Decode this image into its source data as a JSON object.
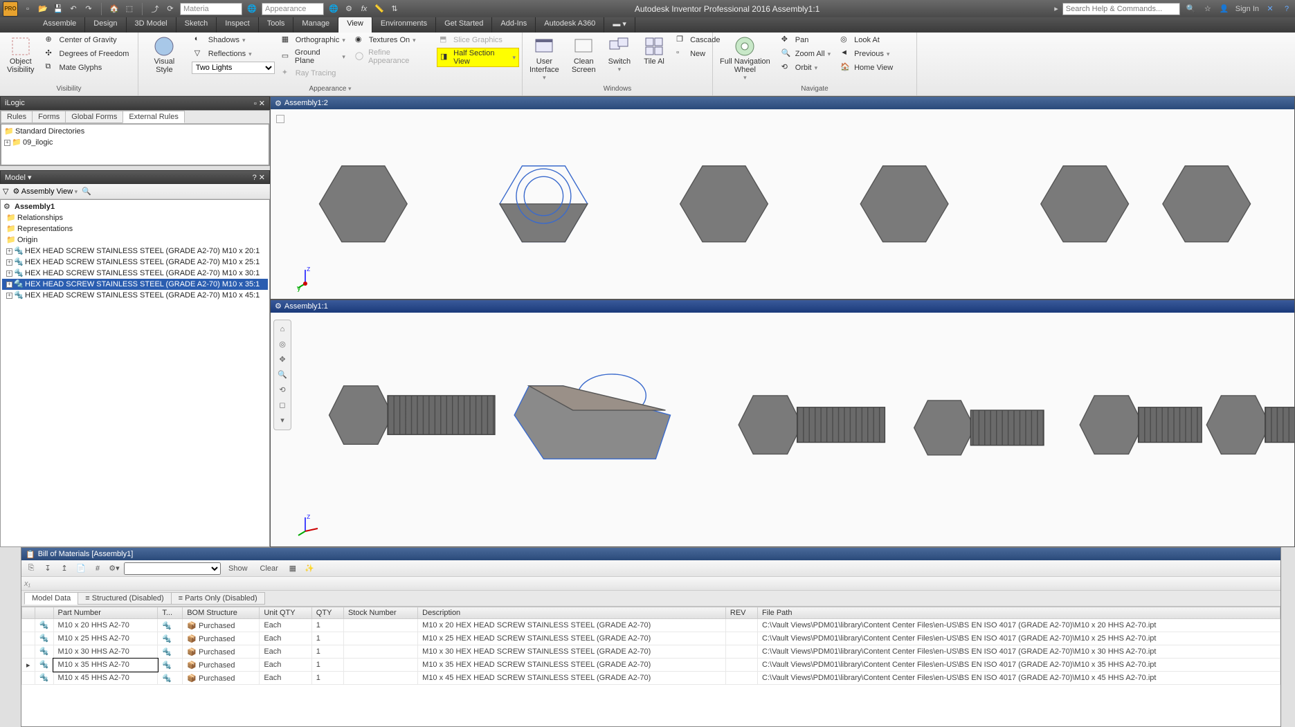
{
  "titlebar": {
    "material_placeholder": "Materia",
    "appearance_placeholder": "Appearance",
    "app_title": "Autodesk Inventor Professional 2016   Assembly1:1",
    "search_placeholder": "Search Help & Commands...",
    "signin": "Sign In"
  },
  "maintabs": [
    "Assemble",
    "Design",
    "3D Model",
    "Sketch",
    "Inspect",
    "Tools",
    "Manage",
    "View",
    "Environments",
    "Get Started",
    "Add-Ins",
    "Autodesk A360"
  ],
  "maintabs_active": 7,
  "ribbon": {
    "visibility": {
      "object_visibility": "Object\nVisibility",
      "center_of_gravity": "Center of Gravity",
      "degrees_of_freedom": "Degrees of Freedom",
      "mate_glyphs": "Mate Glyphs",
      "label": "Visibility"
    },
    "appearance": {
      "visual_style": "Visual Style",
      "shadows": "Shadows",
      "reflections": "Reflections",
      "two_lights": "Two Lights",
      "orthographic": "Orthographic",
      "ground_plane": "Ground Plane",
      "ray_tracing": "Ray Tracing",
      "textures_on": "Textures On",
      "refine_appearance": "Refine Appearance",
      "slice_graphics": "Slice Graphics",
      "half_section_view": "Half Section View",
      "label": "Appearance"
    },
    "windows": {
      "user_interface": "User\nInterface",
      "clean_screen": "Clean\nScreen",
      "switch": "Switch",
      "tile_all": "Tile Al",
      "cascade": "Cascade",
      "new": "New",
      "label": "Windows"
    },
    "navigate": {
      "full_nav_wheel": "Full Navigation\nWheel",
      "pan": "Pan",
      "zoom_all": "Zoom All",
      "orbit": "Orbit",
      "look_at": "Look At",
      "previous": "Previous",
      "home_view": "Home View",
      "label": "Navigate"
    }
  },
  "ilogic": {
    "title": "iLogic",
    "tabs": [
      "Rules",
      "Forms",
      "Global Forms",
      "External Rules"
    ],
    "active_tab": 3,
    "items": [
      "Standard Directories",
      "09_ilogic"
    ]
  },
  "model": {
    "title": "Model",
    "view_label": "Assembly View",
    "root": "Assembly1",
    "nodes": [
      "Relationships",
      "Representations",
      "Origin",
      "HEX HEAD SCREW STAINLESS STEEL (GRADE A2-70) M10 x 20:1",
      "HEX HEAD SCREW STAINLESS STEEL (GRADE A2-70) M10 x 25:1",
      "HEX HEAD SCREW STAINLESS STEEL (GRADE A2-70) M10 x 30:1",
      "HEX HEAD SCREW STAINLESS STEEL (GRADE A2-70) M10 x 35:1",
      "HEX HEAD SCREW STAINLESS STEEL (GRADE A2-70) M10 x 45:1"
    ],
    "selected_index": 6
  },
  "viewports": {
    "vp1_title": "Assembly1:2",
    "vp2_title": "Assembly1:1"
  },
  "bom": {
    "title": "Bill of Materials [Assembly1]",
    "show": "Show",
    "clear": "Clear",
    "tabs": [
      "Model Data",
      "Structured (Disabled)",
      "Parts Only (Disabled)"
    ],
    "active_tab": 0,
    "columns": [
      "Part Number",
      "T...",
      "BOM Structure",
      "Unit QTY",
      "QTY",
      "Stock Number",
      "Description",
      "REV",
      "File Path"
    ],
    "rows": [
      {
        "pn": "M10 x 20 HHS A2-70",
        "bom": "Purchased",
        "uqty": "Each",
        "qty": "1",
        "stock": "",
        "desc": "M10 x 20 HEX HEAD SCREW STAINLESS STEEL (GRADE A2-70)",
        "rev": "",
        "path": "C:\\Vault Views\\PDM01\\library\\Content Center Files\\en-US\\BS EN ISO 4017 (GRADE A2-70)\\M10 x 20 HHS A2-70.ipt"
      },
      {
        "pn": "M10 x 25 HHS A2-70",
        "bom": "Purchased",
        "uqty": "Each",
        "qty": "1",
        "stock": "",
        "desc": "M10 x 25 HEX HEAD SCREW STAINLESS STEEL (GRADE A2-70)",
        "rev": "",
        "path": "C:\\Vault Views\\PDM01\\library\\Content Center Files\\en-US\\BS EN ISO 4017 (GRADE A2-70)\\M10 x 25 HHS A2-70.ipt"
      },
      {
        "pn": "M10 x 30 HHS A2-70",
        "bom": "Purchased",
        "uqty": "Each",
        "qty": "1",
        "stock": "",
        "desc": "M10 x 30 HEX HEAD SCREW STAINLESS STEEL (GRADE A2-70)",
        "rev": "",
        "path": "C:\\Vault Views\\PDM01\\library\\Content Center Files\\en-US\\BS EN ISO 4017 (GRADE A2-70)\\M10 x 30 HHS A2-70.ipt"
      },
      {
        "pn": "M10 x 35 HHS A2-70",
        "bom": "Purchased",
        "uqty": "Each",
        "qty": "1",
        "stock": "",
        "desc": "M10 x 35 HEX HEAD SCREW STAINLESS STEEL (GRADE A2-70)",
        "rev": "",
        "path": "C:\\Vault Views\\PDM01\\library\\Content Center Files\\en-US\\BS EN ISO 4017 (GRADE A2-70)\\M10 x 35 HHS A2-70.ipt"
      },
      {
        "pn": "M10 x 45 HHS A2-70",
        "bom": "Purchased",
        "uqty": "Each",
        "qty": "1",
        "stock": "",
        "desc": "M10 x 45 HEX HEAD SCREW STAINLESS STEEL (GRADE A2-70)",
        "rev": "",
        "path": "C:\\Vault Views\\PDM01\\library\\Content Center Files\\en-US\\BS EN ISO 4017 (GRADE A2-70)\\M10 x 45 HHS A2-70.ipt"
      }
    ],
    "selected_row": 3
  }
}
